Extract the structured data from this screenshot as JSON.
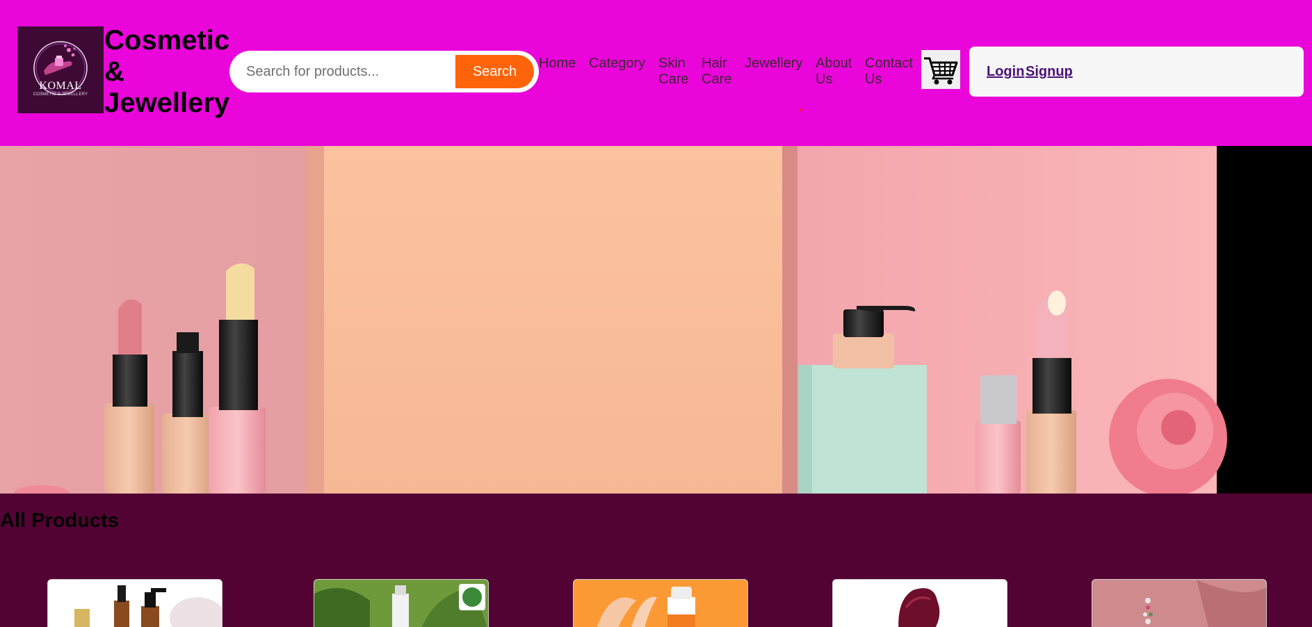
{
  "header": {
    "logo": {
      "icon": "cosmetic-hand-logo-icon",
      "name": "KOMAL",
      "tagline": "COSMETIC & JEWELLERY"
    },
    "brand_title": "Cosmetic & Jewellery",
    "background_color": "#ea05da"
  },
  "search": {
    "placeholder": "Search for products...",
    "button_label": "Search",
    "button_color": "#ff640a"
  },
  "nav": {
    "items": [
      {
        "label": "Home"
      },
      {
        "label": "Category"
      },
      {
        "label": "Skin Care"
      },
      {
        "label": "Hair Care"
      },
      {
        "label": "Jewellery"
      },
      {
        "label": "About Us"
      },
      {
        "label": "Contact Us"
      }
    ]
  },
  "cart": {
    "icon": "shopping-cart-icon"
  },
  "auth": {
    "login_label": "Login",
    "signup_label": "Signup"
  },
  "hero": {
    "image": "cosmetics-banner-lipsticks-pump-bottle-rose"
  },
  "products": {
    "section_title": "All Products",
    "background_color": "#520333",
    "cards": [
      {
        "image": "serum-bottles-cream"
      },
      {
        "image": "organic-bottle-green-leaves"
      },
      {
        "image": "orange-sunscreen-bottle"
      },
      {
        "image": "dark-red-lipstick-swatch"
      },
      {
        "image": "jewellery-earrings-pink"
      }
    ]
  }
}
